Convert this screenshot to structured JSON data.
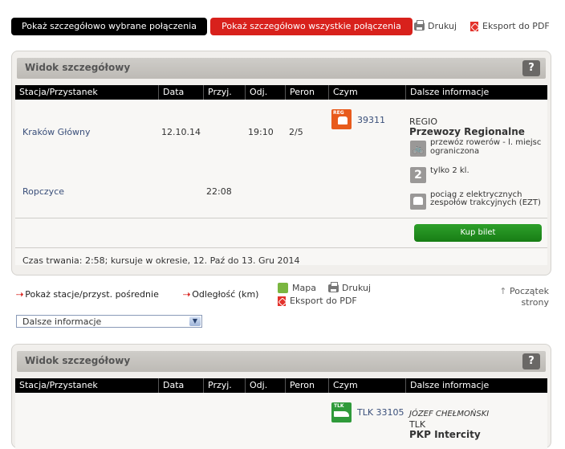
{
  "top": {
    "btn_selected": "Pokaż szczegółowo wybrane połączenia",
    "btn_all": "Pokaż szczegółowo wszystkie połączenia",
    "print": "Drukuj",
    "export_pdf": "Eksport do PDF"
  },
  "colors": {
    "accent_red": "#d8211c",
    "buy_green": "#1f8a1b",
    "header_black": "#000000"
  },
  "panel1": {
    "title": "Widok szczegółowy",
    "help": "?",
    "columns": [
      "Stacja/Przystanek",
      "Data",
      "Przyj.",
      "Odj.",
      "Peron",
      "Czym",
      "Dalsze informacje"
    ],
    "stop_from": {
      "station": "Kraków Główny",
      "date": "12.10.14",
      "dep": "19:10",
      "platform": "2/5"
    },
    "stop_to": {
      "station": "Ropczyce",
      "arr": "22:08"
    },
    "train": {
      "icon": "regio-train-icon",
      "icon_text": "REG",
      "number": "39311"
    },
    "info": {
      "category": "REGIO",
      "operator": "Przewozy Regionalne",
      "feat_bike": "przewóz rowerów - l. miejsc ograniczona",
      "feat_class_num": "2",
      "feat_class": "tylko 2 kl.",
      "feat_ezt": "pociąg z elektrycznych zespołów trakcyjnych (EZT)"
    },
    "buy": "Kup bilet",
    "duration": "Czas trwania: 2:58; kursuje w okresie, 12. Paź do 13. Gru 2014"
  },
  "links": {
    "intermediate": "Pokaż stacje/przyst. pośrednie",
    "distance": "Odległość (km)",
    "map": "Mapa",
    "print": "Drukuj",
    "export_pdf": "Eksport do PDF",
    "top_of_page": "Początek strony",
    "select_value": "Dalsze informacje"
  },
  "panel2": {
    "title": "Widok szczegółowy",
    "help": "?",
    "columns": [
      "Stacja/Przystanek",
      "Data",
      "Przyj.",
      "Odj.",
      "Peron",
      "Czym",
      "Dalsze informacje"
    ],
    "train": {
      "icon": "tlk-train-icon",
      "icon_text": "TLK",
      "number": "TLK 33105"
    },
    "info": {
      "name": "JÓZEF CHEŁMOŃSKI",
      "category": "TLK",
      "operator": "PKP Intercity"
    }
  }
}
